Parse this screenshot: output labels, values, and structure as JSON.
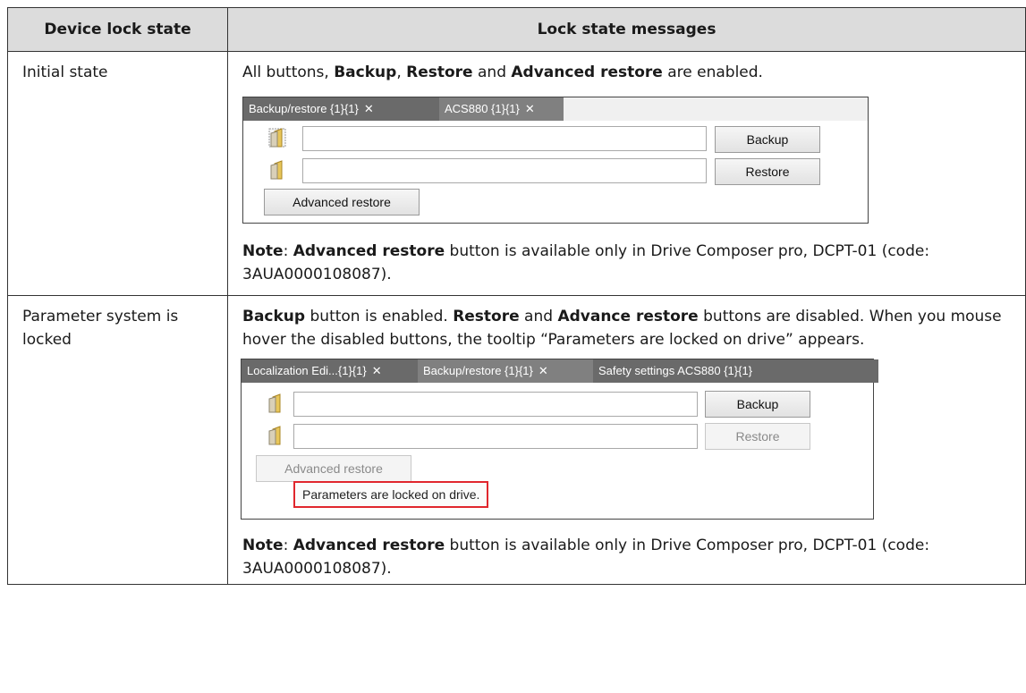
{
  "table": {
    "headers": [
      "Device lock state",
      "Lock state messages"
    ],
    "rows": [
      {
        "state": "Initial state",
        "description_parts": [
          "All buttons, ",
          "Backup",
          ", ",
          "Restore",
          " and ",
          "Advanced restore",
          " are enabled."
        ],
        "screenshot": {
          "tabs": [
            "Backup/restore {1}{1}",
            "ACS880 {1}{1}"
          ],
          "tab_close": "✕",
          "backup_button": "Backup",
          "restore_button": "Restore",
          "advanced_restore_button": "Advanced restore"
        },
        "note_parts": [
          "Note",
          ": ",
          "Advanced restore",
          " button is available only in Drive Composer pro, DCPT-01 (code: 3AUA0000108087)."
        ]
      },
      {
        "state": "Parameter system is locked",
        "description_parts": [
          "Backup",
          " button is enabled. ",
          "Restore",
          " and ",
          "Advance restore",
          " buttons are disabled. When you mouse hover the disabled buttons, the tooltip “Parameters are locked on drive” appears."
        ],
        "screenshot": {
          "tabs": [
            "Localization Edi...{1}{1}",
            "Backup/restore {1}{1}",
            "Safety settings ACS880 {1}{1}"
          ],
          "tab_close": "✕",
          "backup_button": "Backup",
          "restore_button": "Restore",
          "advanced_restore_button": "Advanced restore",
          "tooltip": "Parameters are locked on drive."
        },
        "note_parts": [
          "Note",
          ": ",
          "Advanced restore",
          " button is available only in Drive Composer pro, DCPT-01 (code: 3AUA0000108087)."
        ]
      }
    ]
  },
  "colors": {
    "header_bg": "#dcdcdc",
    "tooltip_border": "#e0262d",
    "tab_bg": "#808080"
  }
}
